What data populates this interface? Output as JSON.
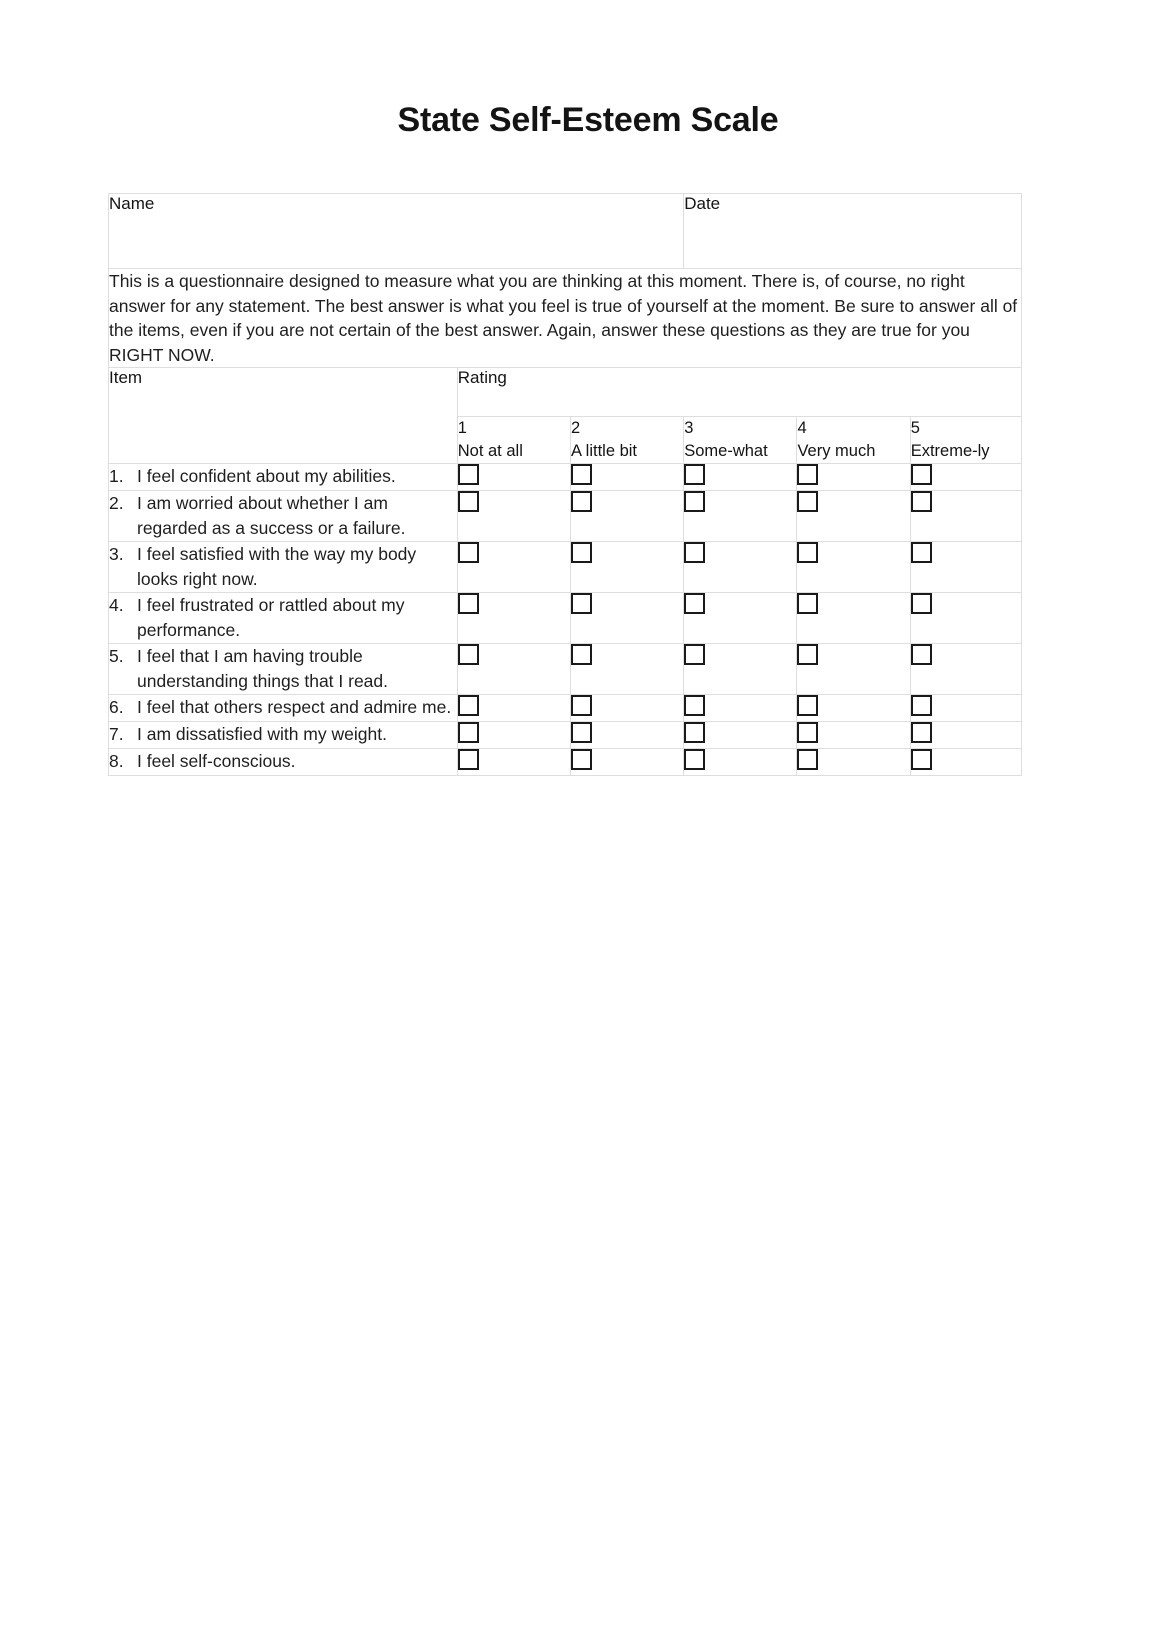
{
  "document": {
    "title": "State Self-Esteem Scale"
  },
  "identity": {
    "name_label": "Name",
    "name_value": "",
    "date_label": "Date",
    "date_value": ""
  },
  "instructions": {
    "text": "This is a questionnaire designed to measure what you are thinking at this moment. There is, of course, no right answer for any statement. The best answer is what you feel is true of yourself at the moment. Be sure to answer all of the items, even if you are not certain of the best answer. Again, answer these questions as they are true for you RIGHT NOW."
  },
  "table": {
    "item_column_header": "Item",
    "rating_group_header": "Rating",
    "scale": [
      {
        "number": "1",
        "label": "Not at all"
      },
      {
        "number": "2",
        "label": "A little bit"
      },
      {
        "number": "3",
        "label": "Some-what"
      },
      {
        "number": "4",
        "label": "Very much"
      },
      {
        "number": "5",
        "label": "Extreme-ly"
      }
    ],
    "items": [
      {
        "number": "1.",
        "text": "I feel confident about my abilities."
      },
      {
        "number": "2.",
        "text": "I am worried about whether I am regarded as a success or a failure."
      },
      {
        "number": "3.",
        "text": "I feel satisfied with the way my body looks right now."
      },
      {
        "number": "4.",
        "text": "I feel frustrated or rattled about my performance."
      },
      {
        "number": "5.",
        "text": "I feel that I am having trouble understanding things that I read."
      },
      {
        "number": "6.",
        "text": "I feel that others respect and admire me."
      },
      {
        "number": "7.",
        "text": "I am dissatisfied with my weight."
      },
      {
        "number": "8.",
        "text": "I feel self-conscious."
      }
    ]
  },
  "style": {
    "border_color": "#dedede",
    "text_color": "#1f1f1f",
    "checkbox_border": "#1a1a1a",
    "page_background": "#ffffff"
  }
}
